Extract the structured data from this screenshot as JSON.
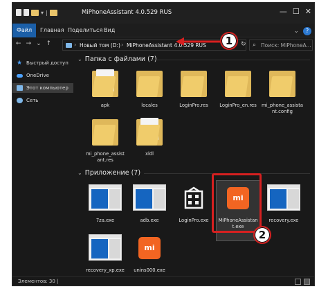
{
  "window": {
    "title": "MiPhoneAssistant 4.0.529 RUS",
    "controls": [
      "—",
      "☐",
      "✕"
    ]
  },
  "ribbon": {
    "tabs": [
      "Файл",
      "Главная",
      "Поделиться",
      "Вид"
    ]
  },
  "address": {
    "crumbs": [
      "Новый том (D:)",
      "MiPhoneAssistant 4.0.529 RUS"
    ],
    "search_placeholder": "Поиск: MiPhoneA..."
  },
  "sidebar": {
    "items": [
      {
        "label": "Быстрый доступ",
        "icon": "star-icon"
      },
      {
        "label": "OneDrive",
        "icon": "cloud-icon"
      },
      {
        "label": "Этот компьютер",
        "icon": "computer-icon"
      },
      {
        "label": "Сеть",
        "icon": "network-icon"
      }
    ]
  },
  "groups": {
    "folders": {
      "title": "Папка с файлами (7)",
      "items": [
        "apk",
        "locales",
        "LoginPro.res",
        "LoginPro_en.res",
        "mi_phone_assistant.config",
        "mi_phone_assistant.res",
        "xldl"
      ]
    },
    "apps": {
      "title": "Приложение (7)",
      "items": [
        "7za.exe",
        "adb.exe",
        "LoginPro.exe",
        "MiPhoneAssistant.exe",
        "recovery.exe",
        "recovery_xp.exe",
        "unins000.exe"
      ]
    }
  },
  "captions": {
    "f0": "apk",
    "f1": "locales",
    "f2": "LoginPro.res",
    "f3": "LoginPro_en.res",
    "f4a": "mi_phone_assista",
    "f4b": "nt.config",
    "f5a": "mi_phone_assist",
    "f5b": "ant.res",
    "f6": "xldl",
    "a0": "7za.exe",
    "a1": "adb.exe",
    "a2": "LoginPro.exe",
    "a3a": "MiPhoneAssistan",
    "a3b": "t.exe",
    "a4": "recovery.exe",
    "a5": "recovery_xp.exe",
    "a6": "unins000.exe"
  },
  "app_icons": {
    "mi_logo": "mi",
    "accent": "#f26522",
    "exe_blue": "#1565c0"
  },
  "status": {
    "count": "Элементов: 30 |"
  },
  "annotations": {
    "step1": "1",
    "step2": "2",
    "color": "#d62020"
  }
}
